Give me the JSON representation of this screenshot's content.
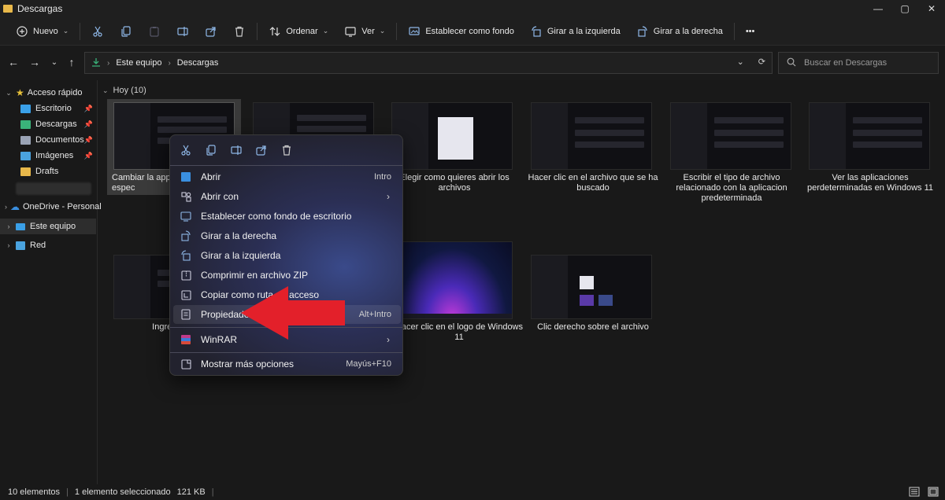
{
  "window": {
    "title": "Descargas",
    "minimize_glyph": "—",
    "maximize_glyph": "▢",
    "close_glyph": "✕"
  },
  "toolbar": {
    "new_label": "Nuevo",
    "sort_label": "Ordenar",
    "view_label": "Ver",
    "set_background_label": "Establecer como fondo",
    "rotate_left_label": "Girar a la izquierda",
    "rotate_right_label": "Girar a la derecha",
    "more_label": "•••"
  },
  "address_bar": {
    "root": "Este equipo",
    "current": "Descargas",
    "search_placeholder": "Buscar en Descargas"
  },
  "sidebar": {
    "quick_access": "Acceso rápido",
    "items": [
      {
        "label": "Escritorio",
        "icon": "desktop-icon",
        "color": "#3aa0e8"
      },
      {
        "label": "Descargas",
        "icon": "download-icon",
        "color": "#3ab37a"
      },
      {
        "label": "Documentos",
        "icon": "document-icon",
        "color": "#9aa3b5"
      },
      {
        "label": "Imágenes",
        "icon": "pictures-icon",
        "color": "#4aa3df"
      },
      {
        "label": "Drafts",
        "icon": "folder-icon",
        "color": "#e8b84a"
      }
    ],
    "onedrive": "OneDrive - Personal",
    "this_pc": "Este equipo",
    "network": "Red"
  },
  "content": {
    "group_label": "Hoy (10)",
    "files": [
      {
        "caption": "Cambiar la app p formato en espec"
      },
      {
        "caption": ""
      },
      {
        "caption": "Elegir como quieres abrir los archivos"
      },
      {
        "caption": "Hacer clic en el archivo que se ha buscado"
      },
      {
        "caption": "Escribir el tipo de archivo relacionado con la aplicacion predeterminada"
      },
      {
        "caption": "Ver las aplicaciones perdeterminadas en Windows 11"
      },
      {
        "caption": "Ingresar en"
      },
      {
        "caption": "Hacer clic en el logo de Windows 11"
      },
      {
        "caption": "Clic derecho sobre el archivo"
      }
    ]
  },
  "context_menu": {
    "items": [
      {
        "label": "Abrir",
        "shortcut": "Intro",
        "icon": "open-icon"
      },
      {
        "label": "Abrir con",
        "shortcut": "",
        "icon": "open-with-icon"
      },
      {
        "label": "Establecer como fondo de escritorio",
        "shortcut": "",
        "icon": "wallpaper-icon"
      },
      {
        "label": "Girar a la derecha",
        "shortcut": "",
        "icon": "rotate-right-icon"
      },
      {
        "label": "Girar a la izquierda",
        "shortcut": "",
        "icon": "rotate-left-icon"
      },
      {
        "label": "Comprimir en archivo ZIP",
        "shortcut": "",
        "icon": "zip-icon"
      },
      {
        "label": "Copiar como ruta de acceso",
        "shortcut": "",
        "icon": "copy-path-icon"
      },
      {
        "label": "Propiedades",
        "shortcut": "Alt+Intro",
        "icon": "properties-icon"
      },
      {
        "label": "WinRAR",
        "shortcut": "",
        "icon": "winrar-icon"
      },
      {
        "label": "Mostrar más opciones",
        "shortcut": "Mayús+F10",
        "icon": "more-options-icon"
      }
    ]
  },
  "status": {
    "count": "10 elementos",
    "selection": "1 elemento seleccionado",
    "size": "121 KB"
  },
  "colors": {
    "accent_arrow": "#e3202a",
    "folder": "#e8b84a",
    "onedrive": "#3a8fe0"
  }
}
